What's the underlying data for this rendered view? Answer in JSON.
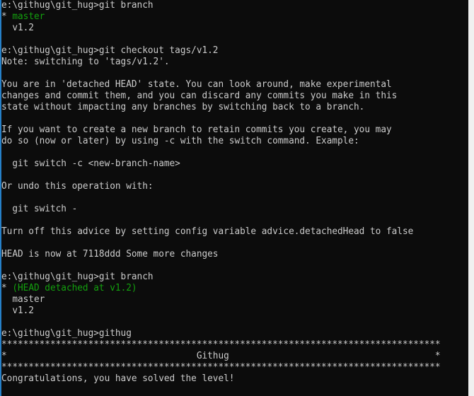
{
  "window": {
    "title": "Command Prompt - githug",
    "background_color": "#0c0c0c",
    "default_text_color": "#cccccc",
    "green_color": "#13a10e",
    "border_color": "#2680c8",
    "scrollbar_color": "#f0f0f0",
    "columns": 81,
    "rows": 35
  },
  "prompt": "e:\\githug\\git_hug>",
  "lines": [
    {
      "id": "l01",
      "name": "prompt-git-branch-1",
      "segments": [
        {
          "text": "e:\\githug\\git_hug>git branch",
          "color": "white"
        }
      ]
    },
    {
      "id": "l02",
      "name": "branch-master-current",
      "segments": [
        {
          "text": "* ",
          "color": "white"
        },
        {
          "text": "master",
          "color": "green"
        }
      ]
    },
    {
      "id": "l03",
      "name": "branch-v12",
      "segments": [
        {
          "text": "  v1.2",
          "color": "white"
        }
      ]
    },
    {
      "id": "l04",
      "name": "blank-line",
      "segments": [
        {
          "text": "",
          "color": "white"
        }
      ]
    },
    {
      "id": "l05",
      "name": "prompt-git-checkout",
      "segments": [
        {
          "text": "e:\\githug\\git_hug>git checkout tags/v1.2",
          "color": "white"
        }
      ]
    },
    {
      "id": "l06",
      "name": "note-switching",
      "segments": [
        {
          "text": "Note: switching to 'tags/v1.2'.",
          "color": "white"
        }
      ]
    },
    {
      "id": "l07",
      "name": "blank-line",
      "segments": [
        {
          "text": "",
          "color": "white"
        }
      ]
    },
    {
      "id": "l08",
      "name": "detached-head-line-1",
      "segments": [
        {
          "text": "You are in 'detached HEAD' state. You can look around, make experimental",
          "color": "white"
        }
      ]
    },
    {
      "id": "l09",
      "name": "detached-head-line-2",
      "segments": [
        {
          "text": "changes and commit them, and you can discard any commits you make in this",
          "color": "white"
        }
      ]
    },
    {
      "id": "l10",
      "name": "detached-head-line-3",
      "segments": [
        {
          "text": "state without impacting any branches by switching back to a branch.",
          "color": "white"
        }
      ]
    },
    {
      "id": "l11",
      "name": "blank-line",
      "segments": [
        {
          "text": "",
          "color": "white"
        }
      ]
    },
    {
      "id": "l12",
      "name": "retain-commits-line-1",
      "segments": [
        {
          "text": "If you want to create a new branch to retain commits you create, you may",
          "color": "white"
        }
      ]
    },
    {
      "id": "l13",
      "name": "retain-commits-line-2",
      "segments": [
        {
          "text": "do so (now or later) by using -c with the switch command. Example:",
          "color": "white"
        }
      ]
    },
    {
      "id": "l14",
      "name": "blank-line",
      "segments": [
        {
          "text": "",
          "color": "white"
        }
      ]
    },
    {
      "id": "l15",
      "name": "example-git-switch-c",
      "segments": [
        {
          "text": "  git switch -c <new-branch-name>",
          "color": "white"
        }
      ]
    },
    {
      "id": "l16",
      "name": "blank-line",
      "segments": [
        {
          "text": "",
          "color": "white"
        }
      ]
    },
    {
      "id": "l17",
      "name": "undo-operation-text",
      "segments": [
        {
          "text": "Or undo this operation with:",
          "color": "white"
        }
      ]
    },
    {
      "id": "l18",
      "name": "blank-line",
      "segments": [
        {
          "text": "",
          "color": "white"
        }
      ]
    },
    {
      "id": "l19",
      "name": "example-git-switch-dash",
      "segments": [
        {
          "text": "  git switch -",
          "color": "white"
        }
      ]
    },
    {
      "id": "l20",
      "name": "blank-line",
      "segments": [
        {
          "text": "",
          "color": "white"
        }
      ]
    },
    {
      "id": "l21",
      "name": "turn-off-advice-text",
      "segments": [
        {
          "text": "Turn off this advice by setting config variable advice.detachedHead to false",
          "color": "white"
        }
      ]
    },
    {
      "id": "l22",
      "name": "blank-line",
      "segments": [
        {
          "text": "",
          "color": "white"
        }
      ]
    },
    {
      "id": "l23",
      "name": "head-is-now-at",
      "segments": [
        {
          "text": "HEAD is now at 7118ddd Some more changes",
          "color": "white"
        }
      ]
    },
    {
      "id": "l24",
      "name": "blank-line",
      "segments": [
        {
          "text": "",
          "color": "white"
        }
      ]
    },
    {
      "id": "l25",
      "name": "prompt-git-branch-2",
      "segments": [
        {
          "text": "e:\\githug\\git_hug>git branch",
          "color": "white"
        }
      ]
    },
    {
      "id": "l26",
      "name": "branch-head-detached",
      "segments": [
        {
          "text": "* ",
          "color": "white"
        },
        {
          "text": "(HEAD detached at v1.2)",
          "color": "green"
        }
      ]
    },
    {
      "id": "l27",
      "name": "branch-master",
      "segments": [
        {
          "text": "  master",
          "color": "white"
        }
      ]
    },
    {
      "id": "l28",
      "name": "branch-v12-2",
      "segments": [
        {
          "text": "  v1.2",
          "color": "white"
        }
      ]
    },
    {
      "id": "l29",
      "name": "blank-line",
      "segments": [
        {
          "text": "",
          "color": "white"
        }
      ]
    },
    {
      "id": "l30",
      "name": "prompt-githug",
      "segments": [
        {
          "text": "e:\\githug\\git_hug>githug",
          "color": "white"
        }
      ]
    },
    {
      "id": "l31",
      "name": "banner-top-rule",
      "segments": [
        {
          "text": "*********************************************************************************",
          "color": "banner"
        }
      ]
    },
    {
      "id": "l32",
      "name": "banner-title-row",
      "segments": [
        {
          "text": "*                                   Githug                                      *",
          "color": "banner"
        }
      ]
    },
    {
      "id": "l33",
      "name": "banner-bottom-rule",
      "segments": [
        {
          "text": "*********************************************************************************",
          "color": "banner"
        }
      ]
    },
    {
      "id": "l34",
      "name": "congratulations-message",
      "segments": [
        {
          "text": "Congratulations, you have solved the level!",
          "color": "white"
        }
      ]
    }
  ]
}
